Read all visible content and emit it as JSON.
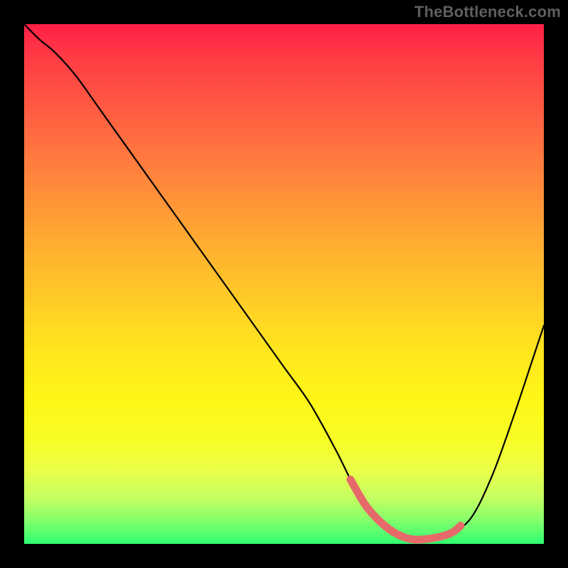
{
  "watermark": "TheBottleneck.com",
  "colors": {
    "background": "#000000",
    "watermark_text": "#5f5f5f",
    "curve": "#000000",
    "valley_highlight": "#e66a6a",
    "gradient_top": "#ff1f47",
    "gradient_bottom": "#30ff72"
  },
  "chart_data": {
    "type": "line",
    "title": "",
    "xlabel": "",
    "ylabel": "",
    "xlim": [
      0,
      100
    ],
    "ylim": [
      0,
      100
    ],
    "grid": false,
    "legend_position": "none",
    "series": [
      {
        "name": "bottleneck-curve",
        "x": [
          0,
          3,
          6,
          10,
          15,
          20,
          25,
          30,
          35,
          40,
          45,
          50,
          55,
          60,
          63,
          66,
          70,
          74,
          78,
          82,
          86,
          90,
          94,
          98,
          100
        ],
        "y": [
          100,
          97,
          94.5,
          90,
          83,
          76,
          69,
          62,
          55,
          48,
          41,
          34,
          27,
          18,
          12,
          7,
          3,
          1,
          1,
          2,
          5,
          13,
          24,
          36,
          42
        ]
      }
    ],
    "annotations": [
      {
        "name": "valley-highlight",
        "x_range": [
          63,
          84
        ],
        "note": "thick red segment drawn along curve near its minimum"
      }
    ],
    "background_gradient": {
      "direction": "vertical",
      "stops": [
        {
          "pos": 0.0,
          "color": "#ff1f47"
        },
        {
          "pos": 0.26,
          "color": "#ff7a3e"
        },
        {
          "pos": 0.56,
          "color": "#ffd424"
        },
        {
          "pos": 0.8,
          "color": "#f8fd25"
        },
        {
          "pos": 1.0,
          "color": "#30ff72"
        }
      ]
    }
  }
}
